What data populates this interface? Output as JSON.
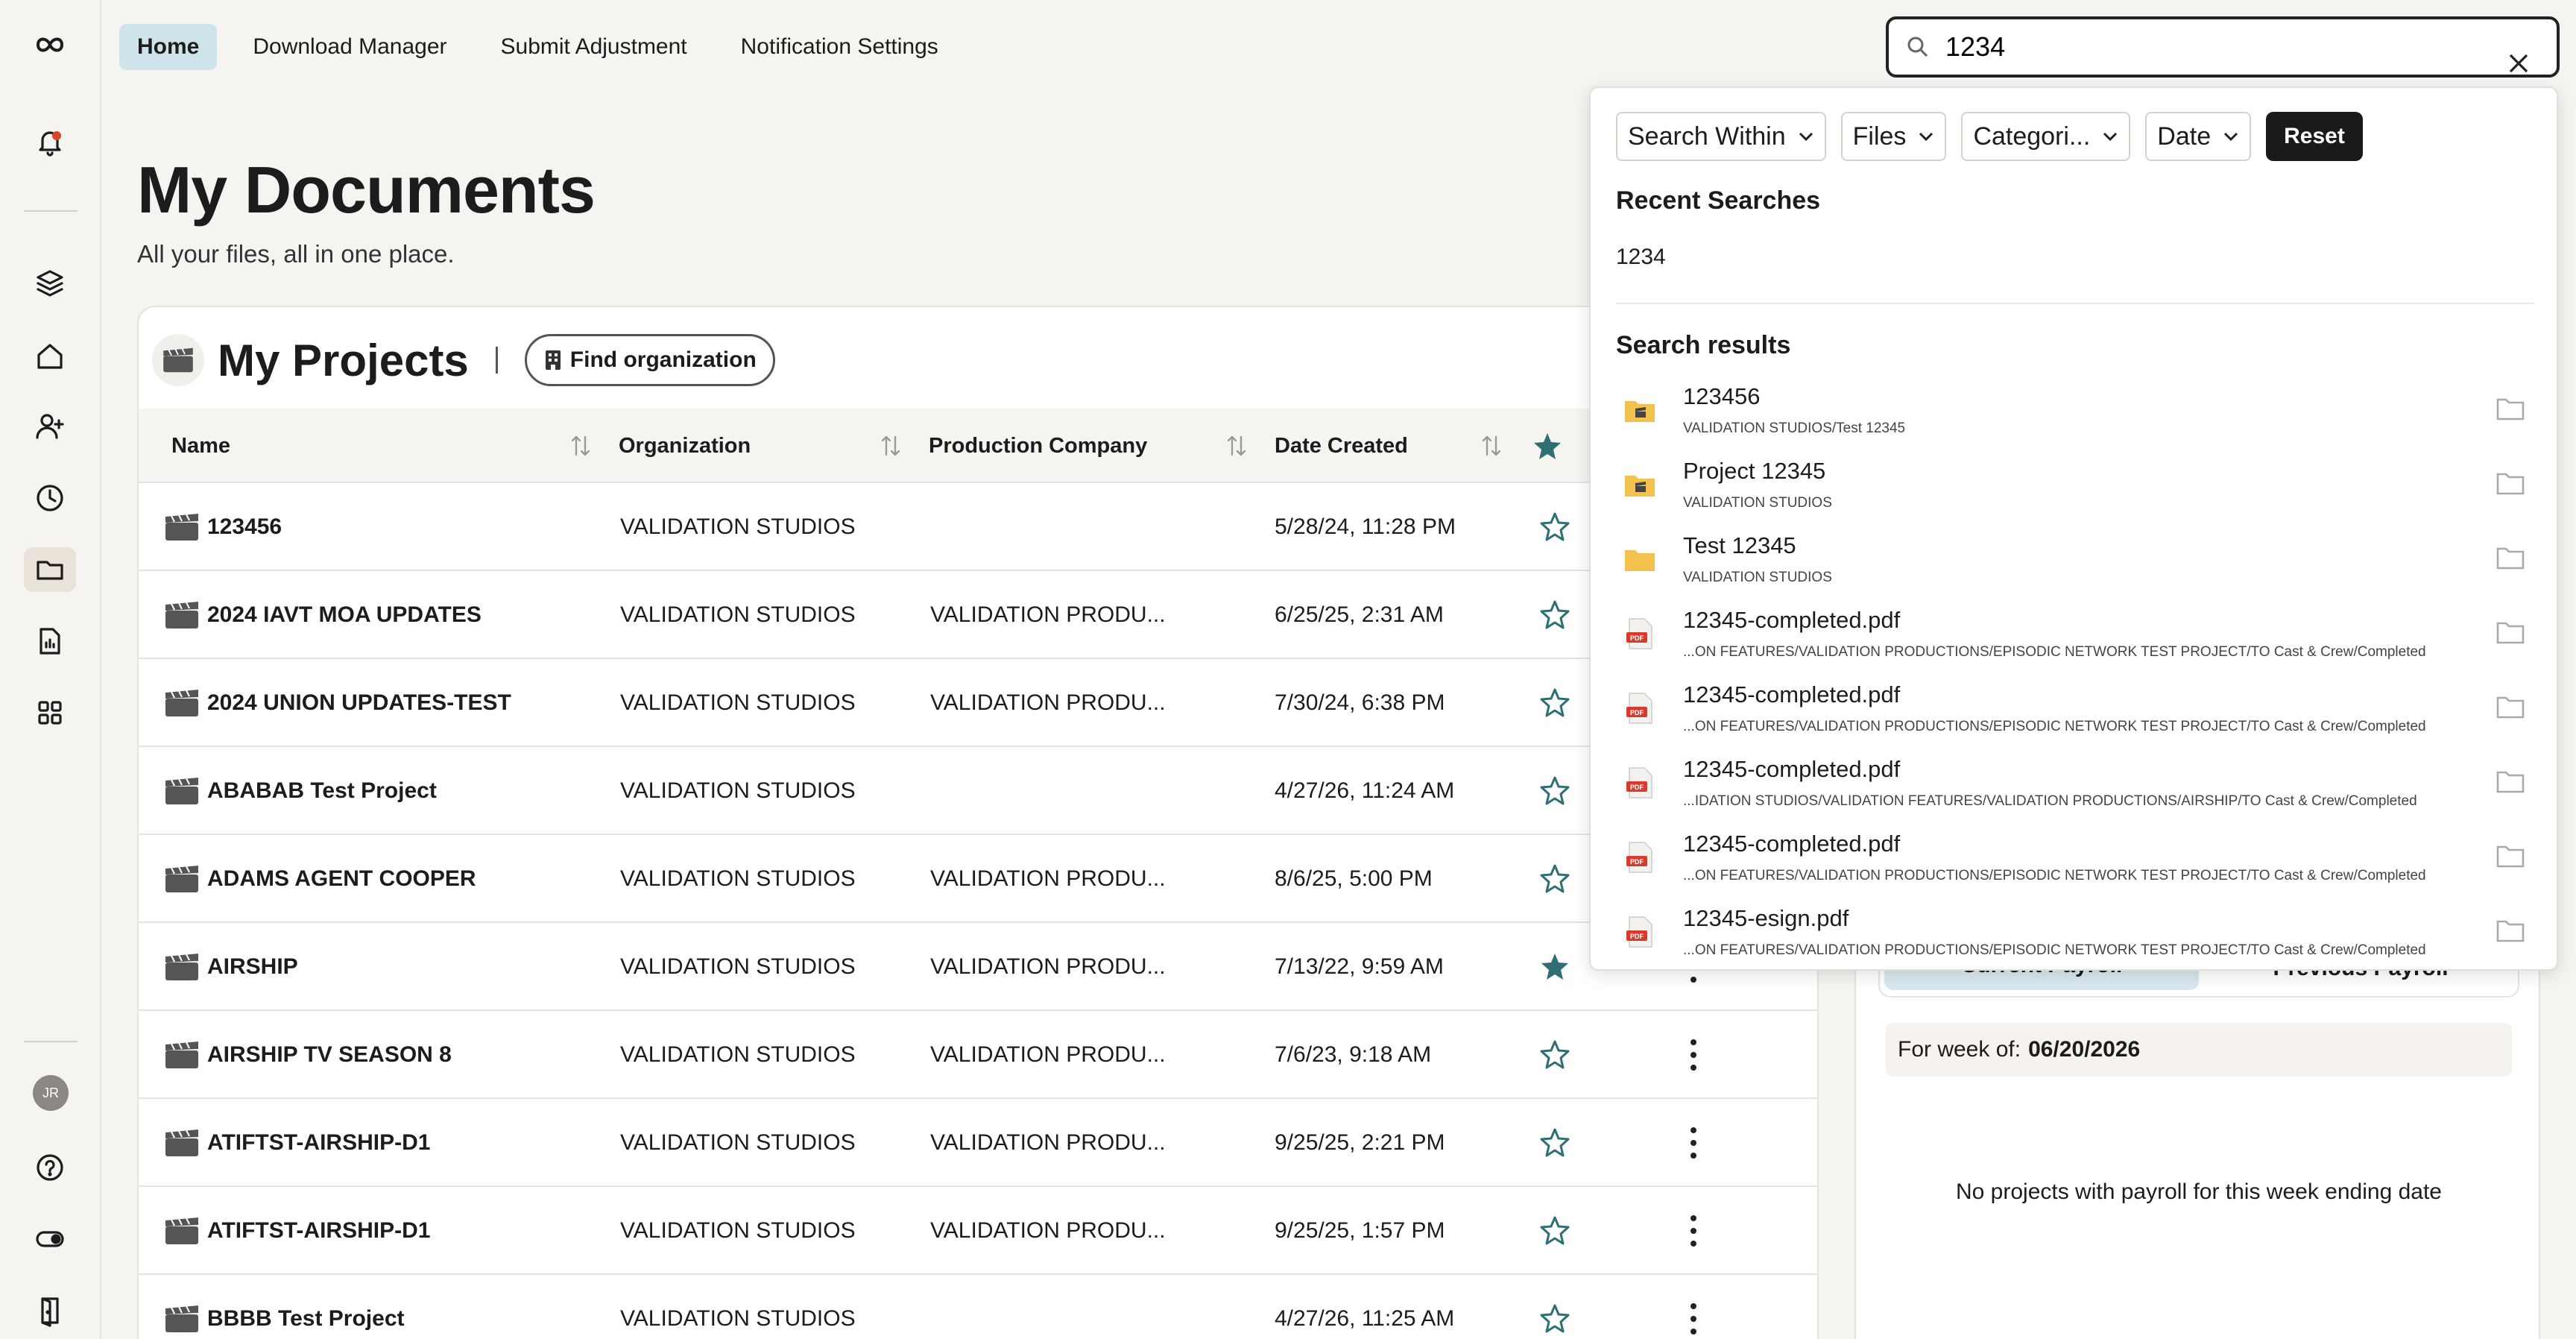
{
  "nav": {
    "items": [
      {
        "label": "Home",
        "active": true
      },
      {
        "label": "Download Manager",
        "active": false
      },
      {
        "label": "Submit Adjustment",
        "active": false
      },
      {
        "label": "Notification Settings",
        "active": false
      }
    ]
  },
  "sidebar": {
    "avatar_initials": "JR",
    "icons": [
      "logo-icon",
      "bell-icon",
      "layers-icon",
      "home-icon",
      "add-user-icon",
      "clock-icon",
      "folder-icon",
      "document-icon",
      "grid-icon",
      "help-icon",
      "toggle-icon",
      "exit-icon"
    ],
    "active": "folder-icon"
  },
  "page": {
    "title": "My Documents",
    "subtitle": "All your files, all in one place."
  },
  "projects": {
    "title": "My Projects",
    "find_org_label": "Find organization",
    "columns": [
      "Name",
      "Organization",
      "Production Company",
      "Date Created"
    ],
    "rows": [
      {
        "name": "123456",
        "org": "VALIDATION STUDIOS",
        "company": "",
        "date": "5/28/24, 11:28 PM",
        "starred": false
      },
      {
        "name": "2024 IAVT MOA UPDATES",
        "org": "VALIDATION STUDIOS",
        "company": "VALIDATION PRODU...",
        "date": "6/25/25, 2:31 AM",
        "starred": false
      },
      {
        "name": "2024 UNION UPDATES-TEST",
        "org": "VALIDATION STUDIOS",
        "company": "VALIDATION PRODU...",
        "date": "7/30/24, 6:38 PM",
        "starred": false
      },
      {
        "name": "ABABAB Test Project",
        "org": "VALIDATION STUDIOS",
        "company": "",
        "date": "4/27/26, 11:24 AM",
        "starred": false
      },
      {
        "name": "ADAMS AGENT COOPER",
        "org": "VALIDATION STUDIOS",
        "company": "VALIDATION PRODU...",
        "date": "8/6/25, 5:00 PM",
        "starred": false
      },
      {
        "name": "AIRSHIP",
        "org": "VALIDATION STUDIOS",
        "company": "VALIDATION PRODU...",
        "date": "7/13/22, 9:59 AM",
        "starred": true
      },
      {
        "name": "AIRSHIP TV SEASON 8",
        "org": "VALIDATION STUDIOS",
        "company": "VALIDATION PRODU...",
        "date": "7/6/23, 9:18 AM",
        "starred": false
      },
      {
        "name": "ATIFTST-AIRSHIP-D1",
        "org": "VALIDATION STUDIOS",
        "company": "VALIDATION PRODU...",
        "date": "9/25/25, 2:21 PM",
        "starred": false
      },
      {
        "name": "ATIFTST-AIRSHIP-D1",
        "org": "VALIDATION STUDIOS",
        "company": "VALIDATION PRODU...",
        "date": "9/25/25, 1:57 PM",
        "starred": false
      },
      {
        "name": "BBBB Test Project",
        "org": "VALIDATION STUDIOS",
        "company": "",
        "date": "4/27/26, 11:25 AM",
        "starred": false
      }
    ]
  },
  "payroll": {
    "tabs": [
      "Current Payroll",
      "Previous Payroll"
    ],
    "week_label": "For week of:",
    "week_date": "06/20/2026",
    "empty_text": "No projects with payroll for this week ending date"
  },
  "search": {
    "value": "1234",
    "filters": [
      "Search Within",
      "Files",
      "Categori...",
      "Date"
    ],
    "reset_label": "Reset",
    "recent_heading": "Recent Searches",
    "recent": [
      "1234"
    ],
    "results_heading": "Search results",
    "results": [
      {
        "title": "123456",
        "path": "VALIDATION STUDIOS/Test 12345",
        "icon": "project-folder-icon"
      },
      {
        "title": "Project 12345",
        "path": "VALIDATION STUDIOS",
        "icon": "project-folder-icon"
      },
      {
        "title": "Test 12345",
        "path": "VALIDATION STUDIOS",
        "icon": "folder-icon"
      },
      {
        "title": "12345-completed.pdf",
        "path": "...ON FEATURES/VALIDATION PRODUCTIONS/EPISODIC NETWORK TEST PROJECT/TO Cast & Crew/Completed",
        "icon": "pdf-icon"
      },
      {
        "title": "12345-completed.pdf",
        "path": "...ON FEATURES/VALIDATION PRODUCTIONS/EPISODIC NETWORK TEST PROJECT/TO Cast & Crew/Completed",
        "icon": "pdf-icon"
      },
      {
        "title": "12345-completed.pdf",
        "path": "...IDATION STUDIOS/VALIDATION FEATURES/VALIDATION PRODUCTIONS/AIRSHIP/TO Cast & Crew/Completed",
        "icon": "pdf-icon"
      },
      {
        "title": "12345-completed.pdf",
        "path": "...ON FEATURES/VALIDATION PRODUCTIONS/EPISODIC NETWORK TEST PROJECT/TO Cast & Crew/Completed",
        "icon": "pdf-icon"
      },
      {
        "title": "12345-esign.pdf",
        "path": "...ON FEATURES/VALIDATION PRODUCTIONS/EPISODIC NETWORK TEST PROJECT/TO Cast & Crew/Completed",
        "icon": "pdf-icon"
      }
    ]
  },
  "colors": {
    "accent_teal": "#2f6f73",
    "nav_active_bg": "#cfe4ea",
    "notification_dot": "#d9452b",
    "pdf_red": "#d93a2b",
    "folder_yellow": "#f2c14e"
  }
}
